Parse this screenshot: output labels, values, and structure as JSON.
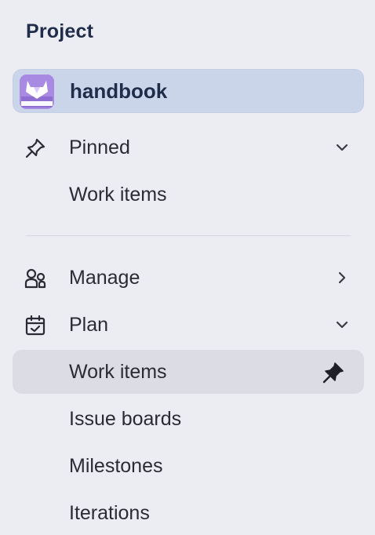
{
  "sidebar": {
    "section_title": "Project",
    "project": {
      "name": "handbook",
      "avatar_icon": "gitlab-handbook-icon",
      "avatar_color": "#a98ae3"
    },
    "pinned": {
      "label": "Pinned",
      "icon": "pin-icon",
      "expanded": true,
      "items": [
        {
          "label": "Work items"
        }
      ]
    },
    "manage": {
      "label": "Manage",
      "icon": "users-icon",
      "expanded": false
    },
    "plan": {
      "label": "Plan",
      "icon": "calendar-check-icon",
      "expanded": true,
      "items": [
        {
          "label": "Work items",
          "active": true,
          "pinned": true
        },
        {
          "label": "Issue boards"
        },
        {
          "label": "Milestones"
        },
        {
          "label": "Iterations"
        }
      ]
    },
    "colors": {
      "background": "#ececf3",
      "project_highlight": "#cbd5ea",
      "active_item": "#dcdce5",
      "title_text": "#1f2d4a"
    }
  }
}
